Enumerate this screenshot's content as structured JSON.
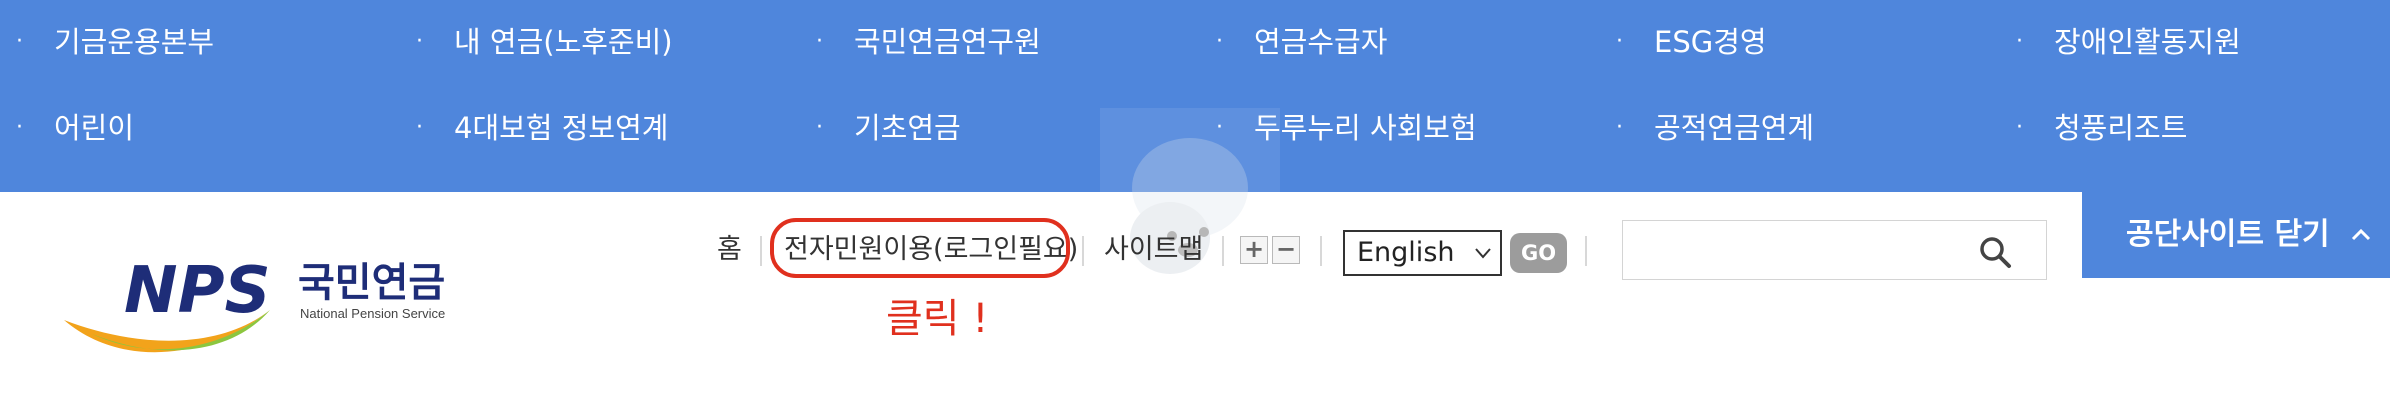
{
  "family_sites": {
    "row1": [
      "기금운용본부",
      "내 연금(노후준비)",
      "국민연금연구원",
      "연금수급자",
      "ESG경영",
      "장애인활동지원"
    ],
    "row2": [
      "어린이",
      "4대보험 정보연계",
      "기초연금",
      "두루누리 사회보험",
      "공적연금연계",
      "청풍리조트"
    ],
    "bullet": "·"
  },
  "logo": {
    "brand": "NPS",
    "korean": "국민연금",
    "english": "National Pension Service"
  },
  "util_nav": {
    "home": "홈",
    "e_civil": "전자민원이용(로그인필요)",
    "sitemap": "사이트맵",
    "zoom_in": "+",
    "zoom_out": "−"
  },
  "language": {
    "selected": "English",
    "go_label": "GO"
  },
  "search": {
    "placeholder": ""
  },
  "annotation": "클릭 !",
  "close_sites_label": "공단사이트 닫기",
  "colors": {
    "menu_blue": "#4f86dc",
    "annotation_red": "#e0301e",
    "logo_navy": "#1e2d78"
  }
}
